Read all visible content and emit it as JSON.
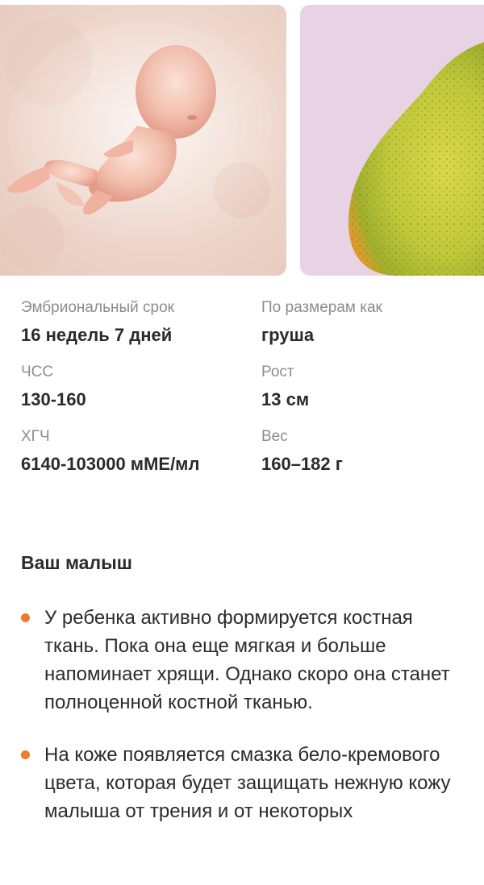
{
  "cards": [
    {
      "name": "embryo",
      "alt": "embryo illustration"
    },
    {
      "name": "pear",
      "alt": "pear"
    }
  ],
  "stats": {
    "embryonic_term": {
      "label": "Эмбриональный срок",
      "value": "16 недель 7 дней"
    },
    "size_like": {
      "label": "По размерам как",
      "value": "груша"
    },
    "heart_rate": {
      "label": "ЧСС",
      "value": "130-160"
    },
    "height": {
      "label": "Рост",
      "value": "13 см"
    },
    "hcg": {
      "label": "ХГЧ",
      "value": "6140-103000 мМЕ/мл"
    },
    "weight": {
      "label": "Вес",
      "value": "160–182 г"
    }
  },
  "section": {
    "title": "Ваш малыш",
    "bullets": [
      "У ребенка активно формируется костная ткань. Пока она еще мягкая и больше напоминает хрящи. Однако скоро она станет полноценной костной тканью.",
      "На коже появляется смазка бело-кремового цвета, которая будет защищать нежную кожу малыша от трения и от некоторых"
    ]
  },
  "colors": {
    "accent_bullet": "#f07a2b",
    "label_gray": "#8d8d8d",
    "text_dark": "#2b2b2b",
    "pear_card_bg": "#e7d3e3"
  }
}
